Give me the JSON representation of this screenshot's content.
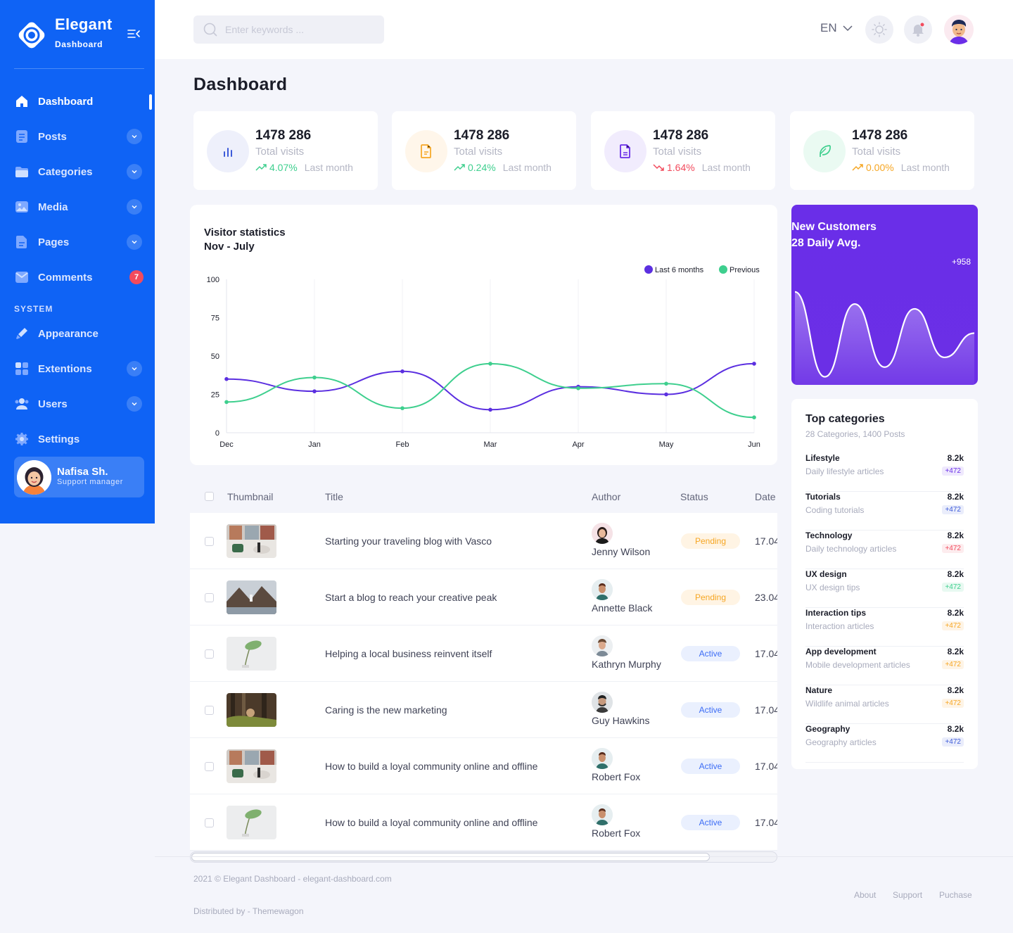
{
  "brand": {
    "name": "Elegant",
    "subtitle": "Dashboard"
  },
  "sidebar": {
    "items": [
      {
        "label": "Dashboard",
        "icon": "home-icon",
        "active": true
      },
      {
        "label": "Posts",
        "icon": "document-icon",
        "expandable": true
      },
      {
        "label": "Categories",
        "icon": "folder-icon",
        "expandable": true
      },
      {
        "label": "Media",
        "icon": "image-icon",
        "expandable": true
      },
      {
        "label": "Pages",
        "icon": "pages-icon",
        "expandable": true
      },
      {
        "label": "Comments",
        "icon": "message-icon",
        "badge": "7"
      }
    ],
    "section_label": "SYSTEM",
    "system_items": [
      {
        "label": "Appearance",
        "icon": "brush-icon"
      },
      {
        "label": "Extentions",
        "icon": "grid-icon",
        "expandable": true
      },
      {
        "label": "Users",
        "icon": "users-icon",
        "expandable": true
      },
      {
        "label": "Settings",
        "icon": "gear-icon"
      }
    ],
    "user": {
      "name": "Nafisa Sh.",
      "role": "Support manager"
    }
  },
  "header": {
    "search_placeholder": "Enter keywords ...",
    "language": "EN"
  },
  "page_title": "Dashboard",
  "stats": [
    {
      "value": "1478 286",
      "label": "Total visits",
      "change": "4.07%",
      "change_label": "Last month",
      "direction": "up",
      "change_color": "#3ecf8e",
      "icon": "bar-chart-icon",
      "icon_color": "#3d5bd9",
      "circle_bg": "#eef0fb"
    },
    {
      "value": "1478 286",
      "label": "Total visits",
      "change": "0.24%",
      "change_label": "Last month",
      "direction": "up",
      "change_color": "#3ecf8e",
      "icon": "file-icon",
      "icon_color": "#f6a623",
      "circle_bg": "#fff6ea"
    },
    {
      "value": "1478 286",
      "label": "Total visits",
      "change": "1.64%",
      "change_label": "Last month",
      "direction": "down",
      "change_color": "#f24b5d",
      "icon": "document-icon",
      "icon_color": "#6a2ee8",
      "circle_bg": "#f1ecfd"
    },
    {
      "value": "1478 286",
      "label": "Total visits",
      "change": "0.00%",
      "change_label": "Last month",
      "direction": "up",
      "change_color": "#f6a623",
      "icon": "feather-icon",
      "icon_color": "#3ecf8e",
      "circle_bg": "#eafaf2"
    }
  ],
  "visitor_chart": {
    "title": "Visitor statistics",
    "subtitle": "Nov - July"
  },
  "chart_data": [
    {
      "type": "line",
      "title": "Visitor statistics",
      "subtitle": "Nov - July",
      "categories": [
        "Dec",
        "Jan",
        "Feb",
        "Mar",
        "Apr",
        "May",
        "Jun"
      ],
      "ylim": [
        0,
        100
      ],
      "yticks": [
        0,
        25,
        50,
        75,
        100
      ],
      "legend": "top-right",
      "grid": "vertical",
      "series": [
        {
          "name": "Last 6 months",
          "color": "#5b2fe0",
          "values": [
            35,
            27,
            40,
            15,
            30,
            25,
            45
          ]
        },
        {
          "name": "Previous",
          "color": "#3ecf8e",
          "values": [
            20,
            36,
            16,
            45,
            29,
            32,
            10
          ]
        }
      ]
    },
    {
      "type": "area",
      "title": "New Customers",
      "subtitle": "28 Daily Avg.",
      "annotation": "+958",
      "values": [
        72,
        2,
        62,
        10,
        58,
        18,
        38
      ]
    }
  ],
  "new_customers": {
    "title": "New Customers",
    "subtitle": "28 Daily Avg.",
    "badge": "+958"
  },
  "top_categories": {
    "title": "Top categories",
    "subtitle": "28 Categories, 1400 Posts",
    "items": [
      {
        "name": "Lifestyle",
        "desc": "Daily lifestyle articles",
        "value": "8.2k",
        "change": "+472",
        "color": "#6a2ee8",
        "bg": "#efe9fd"
      },
      {
        "name": "Tutorials",
        "desc": "Coding tutorials",
        "value": "8.2k",
        "change": "+472",
        "color": "#3d5bd9",
        "bg": "#eaedfb"
      },
      {
        "name": "Technology",
        "desc": "Daily technology articles",
        "value": "8.2k",
        "change": "+472",
        "color": "#f24b5d",
        "bg": "#fdecee"
      },
      {
        "name": "UX design",
        "desc": "UX design tips",
        "value": "8.2k",
        "change": "+472",
        "color": "#3ecf8e",
        "bg": "#e8f9f1"
      },
      {
        "name": "Interaction tips",
        "desc": "Interaction articles",
        "value": "8.2k",
        "change": "+472",
        "color": "#f6a623",
        "bg": "#fef4e6"
      },
      {
        "name": "App development",
        "desc": "Mobile development articles",
        "value": "8.2k",
        "change": "+472",
        "color": "#f6a623",
        "bg": "#fef4e6"
      },
      {
        "name": "Nature",
        "desc": "Wildlife animal articles",
        "value": "8.2k",
        "change": "+472",
        "color": "#f6a623",
        "bg": "#fef4e6"
      },
      {
        "name": "Geography",
        "desc": "Geography articles",
        "value": "8.2k",
        "change": "+472",
        "color": "#3d5bd9",
        "bg": "#eaedfb"
      }
    ]
  },
  "table": {
    "headers": [
      "Thumbnail",
      "Title",
      "Author",
      "Status",
      "Date"
    ],
    "rows": [
      {
        "title": "Starting your traveling blog with Vasco",
        "author": "Jenny Wilson",
        "status": "Pending",
        "date": "17.04",
        "thumb": "living-room"
      },
      {
        "title": "Start a blog to reach your creative peak",
        "author": "Annette Black",
        "status": "Pending",
        "date": "23.04",
        "thumb": "mountain"
      },
      {
        "title": "Helping a local business reinvent itself",
        "author": "Kathryn Murphy",
        "status": "Active",
        "date": "17.04",
        "thumb": "plant"
      },
      {
        "title": "Caring is the new marketing",
        "author": "Guy Hawkins",
        "status": "Active",
        "date": "17.04",
        "thumb": "forest"
      },
      {
        "title": "How to build a loyal community online and offline",
        "author": "Robert Fox",
        "status": "Active",
        "date": "17.04",
        "thumb": "living-room"
      },
      {
        "title": "How to build a loyal community online and offline",
        "author": "Robert Fox",
        "status": "Active",
        "date": "17.04",
        "thumb": "plant"
      }
    ]
  },
  "footer": {
    "copyright": "2021 © Elegant Dashboard - elegant-dashboard.com",
    "distributed": "Distributed by - Themewagon",
    "links": [
      "About",
      "Support",
      "Puchase"
    ]
  },
  "colors": {
    "sidebar": "#0f63f5",
    "accent_purple": "#6a2ee8",
    "pending_text": "#f6a623",
    "pending_bg": "#fff4e4",
    "active_text": "#3d6df5",
    "active_bg": "#eaf0fe"
  }
}
